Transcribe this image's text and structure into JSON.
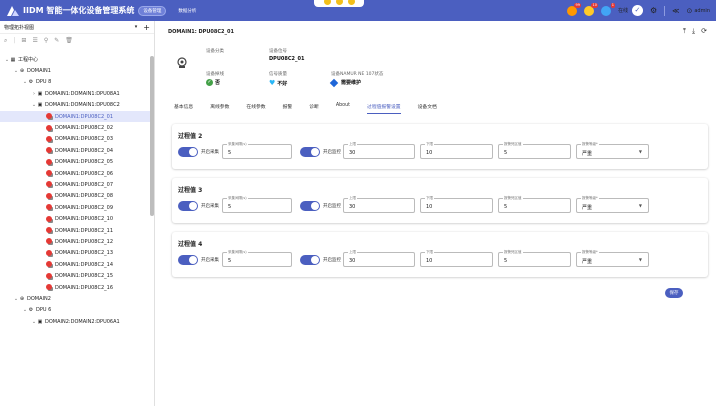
{
  "app": {
    "title": "IIDM 智能一体化设备管理系统",
    "mode_badge": "设备管理",
    "nav_link": "数据分析"
  },
  "topbar": {
    "status_label": "在线",
    "user": "admin",
    "badge1": "99",
    "badge2": "10",
    "badge3": "1"
  },
  "sidebar": {
    "view_select": "物理拓扑视图",
    "tree": [
      {
        "label": "工程中心",
        "level": 0,
        "exp": "v",
        "icon": "grid"
      },
      {
        "label": "DOMAIN1",
        "level": 1,
        "exp": "v",
        "icon": "globe"
      },
      {
        "label": "DPU 8",
        "level": 2,
        "exp": "v",
        "icon": "gear"
      },
      {
        "label": "DOMAIN1:DOMAIN1:DPU08A1",
        "level": 3,
        "exp": ">",
        "icon": "box"
      },
      {
        "label": "DOMAIN1:DOMAIN1:DPU08C2",
        "level": 3,
        "exp": "v",
        "icon": "box"
      },
      {
        "label": "DOMAIN1:DPU08C2_01",
        "level": 4,
        "exp": "",
        "icon": "dev",
        "selected": true
      },
      {
        "label": "DOMAIN1:DPU08C2_02",
        "level": 4,
        "exp": "",
        "icon": "dev"
      },
      {
        "label": "DOMAIN1:DPU08C2_03",
        "level": 4,
        "exp": "",
        "icon": "dev"
      },
      {
        "label": "DOMAIN1:DPU08C2_04",
        "level": 4,
        "exp": "",
        "icon": "dev"
      },
      {
        "label": "DOMAIN1:DPU08C2_05",
        "level": 4,
        "exp": "",
        "icon": "dev"
      },
      {
        "label": "DOMAIN1:DPU08C2_06",
        "level": 4,
        "exp": "",
        "icon": "dev"
      },
      {
        "label": "DOMAIN1:DPU08C2_07",
        "level": 4,
        "exp": "",
        "icon": "dev"
      },
      {
        "label": "DOMAIN1:DPU08C2_08",
        "level": 4,
        "exp": "",
        "icon": "dev"
      },
      {
        "label": "DOMAIN1:DPU08C2_09",
        "level": 4,
        "exp": "",
        "icon": "dev"
      },
      {
        "label": "DOMAIN1:DPU08C2_10",
        "level": 4,
        "exp": "",
        "icon": "dev"
      },
      {
        "label": "DOMAIN1:DPU08C2_11",
        "level": 4,
        "exp": "",
        "icon": "dev"
      },
      {
        "label": "DOMAIN1:DPU08C2_12",
        "level": 4,
        "exp": "",
        "icon": "dev"
      },
      {
        "label": "DOMAIN1:DPU08C2_13",
        "level": 4,
        "exp": "",
        "icon": "dev"
      },
      {
        "label": "DOMAIN1:DPU08C2_14",
        "level": 4,
        "exp": "",
        "icon": "dev"
      },
      {
        "label": "DOMAIN1:DPU08C2_15",
        "level": 4,
        "exp": "",
        "icon": "dev"
      },
      {
        "label": "DOMAIN1:DPU08C2_16",
        "level": 4,
        "exp": "",
        "icon": "dev"
      },
      {
        "label": "DOMAIN2",
        "level": 1,
        "exp": "v",
        "icon": "globe"
      },
      {
        "label": "DPU 6",
        "level": 2,
        "exp": "v",
        "icon": "gear"
      },
      {
        "label": "DOMAIN2:DOMAIN2:DPU06A1",
        "level": 3,
        "exp": "v",
        "icon": "box"
      }
    ]
  },
  "device": {
    "title": "DOMAIN1: DPU08C2_01",
    "category_label": "设备分类",
    "category_value": "",
    "tag_label": "设备位号",
    "tag_value": "DPU08C2_01",
    "alarm_label": "设备掉线",
    "alarm_value": "否",
    "signal_label": "信号质量",
    "signal_value": "不好",
    "namur_label": "设备NAMUR NE 107状态",
    "namur_value": "需要维护"
  },
  "tabs": [
    "基本信息",
    "离线参数",
    "在线参数",
    "报警",
    "诊断",
    "About",
    "过程值报警设置",
    "设备文档"
  ],
  "active_tab_index": 6,
  "cards": [
    {
      "title": "过程值 2",
      "enable_label": "开启采集",
      "interval_label": "采集间隔(s)",
      "interval": "5",
      "monitor_label": "开启监控",
      "upper_label": "上限",
      "upper": "30",
      "lower_label": "下限",
      "lower": "10",
      "deadband_label": "报警死区值",
      "deadband": "5",
      "level_label": "报警等级*",
      "level": "严重"
    },
    {
      "title": "过程值 3",
      "enable_label": "开启采集",
      "interval_label": "采集间隔(s)",
      "interval": "5",
      "monitor_label": "开启监控",
      "upper_label": "上限",
      "upper": "30",
      "lower_label": "下限",
      "lower": "10",
      "deadband_label": "报警死区值",
      "deadband": "5",
      "level_label": "报警等级*",
      "level": "严重"
    },
    {
      "title": "过程值 4",
      "enable_label": "开启采集",
      "interval_label": "采集间隔(s)",
      "interval": "5",
      "monitor_label": "开启监控",
      "upper_label": "上限",
      "upper": "30",
      "lower_label": "下限",
      "lower": "10",
      "deadband_label": "报警死区值",
      "deadband": "5",
      "level_label": "报警等级*",
      "level": "严重"
    }
  ],
  "save_label": "保存",
  "colors": {
    "primary": "#4b5fc0",
    "alarm": "#e53935",
    "ok": "#43a047",
    "warn": "#1e66d8"
  }
}
